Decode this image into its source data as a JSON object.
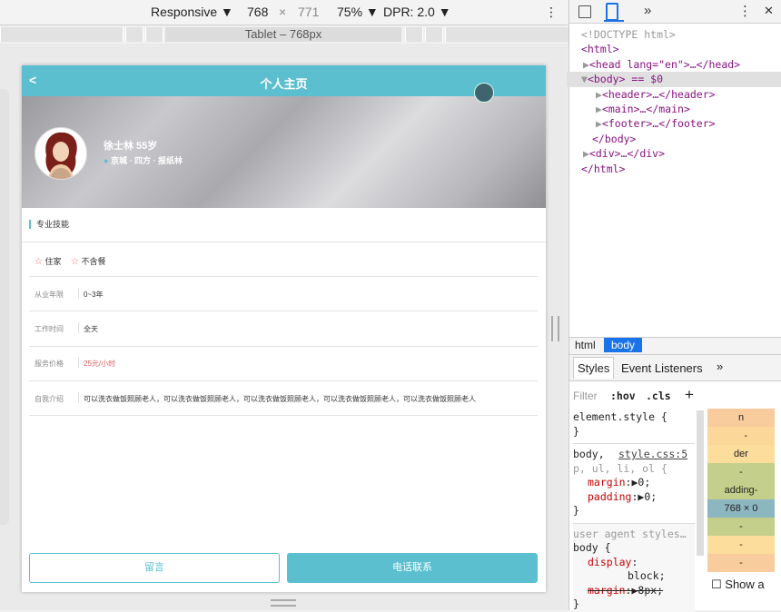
{
  "devbar": {
    "mode": "Responsive",
    "width": "768",
    "times": "×",
    "height": "771",
    "zoom": "75%",
    "dpr": "DPR: 2.0",
    "more": "⋮"
  },
  "ruler": {
    "label": "Tablet – 768px"
  },
  "app": {
    "back": "<",
    "title": "个人主页",
    "profile": {
      "name": "徐士林 55岁",
      "location": "京城 · 四方 · 报纸林"
    },
    "section_title": "专业技能",
    "tags": [
      "住家",
      "不含餐"
    ],
    "rows": [
      {
        "label": "从业年限",
        "value": "0~3年"
      },
      {
        "label": "工作时间",
        "value": "全天"
      },
      {
        "label": "服务价格",
        "value": "25元/小时"
      },
      {
        "label": "自我介绍",
        "value": "可以洗衣做饭照顾老人，可以洗衣做饭照顾老人，可以洗衣做饭照顾老人，可以洗衣做饭照顾老人，可以洗衣做饭照顾老人"
      }
    ],
    "btn_message": "留言",
    "btn_call": "电话联系",
    "accent": "#5bbfcf",
    "price_color": "#e05a5a"
  },
  "devtools": {
    "tab_more": "»",
    "more": "⋮",
    "close": "✕",
    "dom": [
      "<!DOCTYPE html>",
      "<html>",
      "<head lang=\"en\">…</head>",
      "<body> == $0",
      "<header>…</header>",
      "<main>…</main>",
      "<footer>…</footer>",
      "</body>",
      "<div>…</div>",
      "</html>"
    ],
    "crumbs": [
      "html",
      "body"
    ],
    "tabs": [
      "Styles",
      "Event Listeners",
      "»"
    ],
    "filter": "Filter",
    "hov": ":hov",
    "cls": ".cls",
    "plus": "+",
    "rules": {
      "element_style": "element.style {",
      "close_brace": "}",
      "selector1": "body,",
      "source1": "style.css:5",
      "selector1b": "p, ul, li, ol {",
      "prop_margin": "margin",
      "prop_margin_val": "▶0;",
      "prop_padding": "padding",
      "prop_padding_val": "▶0;",
      "ua": "user agent styles…",
      "body_open": "body {",
      "prop_display": "display",
      "display_val": "block;",
      "prop_margin2": "margin",
      "margin2_val": "▶8px;"
    },
    "boxmodel": [
      "n",
      "-",
      "der",
      "-",
      "adding-",
      "768 × 0",
      "-",
      "-",
      "-"
    ],
    "show_all": "Show a"
  }
}
